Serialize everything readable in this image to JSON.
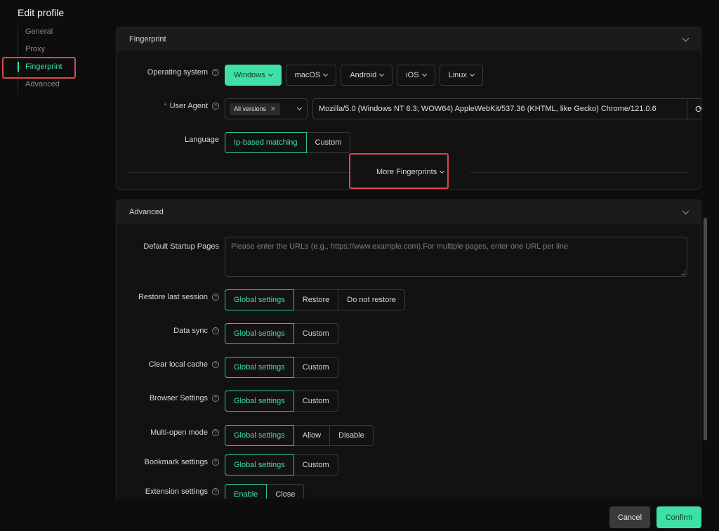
{
  "title": "Edit profile",
  "sidebar": {
    "items": [
      {
        "label": "General"
      },
      {
        "label": "Proxy"
      },
      {
        "label": "Fingerprint"
      },
      {
        "label": "Advanced"
      }
    ]
  },
  "fingerprint": {
    "header": "Fingerprint",
    "os": {
      "label": "Operating system",
      "options": [
        "Windows",
        "macOS",
        "Android",
        "iOS",
        "Linux"
      ],
      "selected": "Windows"
    },
    "user_agent": {
      "label": "User Agent",
      "version_tag": "All versions",
      "value": "Mozilla/5.0 (Windows NT 6.3; WOW64) AppleWebKit/537.36 (KHTML, like Gecko) Chrome/121.0.6"
    },
    "language": {
      "label": "Language",
      "options": [
        "Ip-based matching",
        "Custom"
      ],
      "selected": "Ip-based matching"
    },
    "more": "More Fingerprints"
  },
  "advanced": {
    "header": "Advanced",
    "startup": {
      "label": "Default Startup Pages",
      "placeholder": "Please enter the URLs (e.g., https://www.example.com).For multiple pages, enter one URL per line"
    },
    "restore": {
      "label": "Restore last session",
      "options": [
        "Global settings",
        "Restore",
        "Do not restore"
      ],
      "selected": "Global settings"
    },
    "data_sync": {
      "label": "Data sync",
      "options": [
        "Global settings",
        "Custom"
      ],
      "selected": "Global settings"
    },
    "clear_cache": {
      "label": "Clear local cache",
      "options": [
        "Global settings",
        "Custom"
      ],
      "selected": "Global settings"
    },
    "browser_settings": {
      "label": "Browser Settings",
      "options": [
        "Global settings",
        "Custom"
      ],
      "selected": "Global settings"
    },
    "multi_open": {
      "label": "Multi-open mode",
      "options": [
        "Global settings",
        "Allow",
        "Disable"
      ],
      "selected": "Global settings"
    },
    "bookmark": {
      "label": "Bookmark settings",
      "options": [
        "Global settings",
        "Custom"
      ],
      "selected": "Global settings"
    },
    "extension": {
      "label": "Extension settings",
      "options": [
        "Enable",
        "Close"
      ],
      "selected": "Enable"
    }
  },
  "footer": {
    "cancel": "Cancel",
    "confirm": "Confirm"
  },
  "colors": {
    "accent": "#3fe0a6",
    "highlight": "#e0474c",
    "background": "#0d0d0d"
  }
}
